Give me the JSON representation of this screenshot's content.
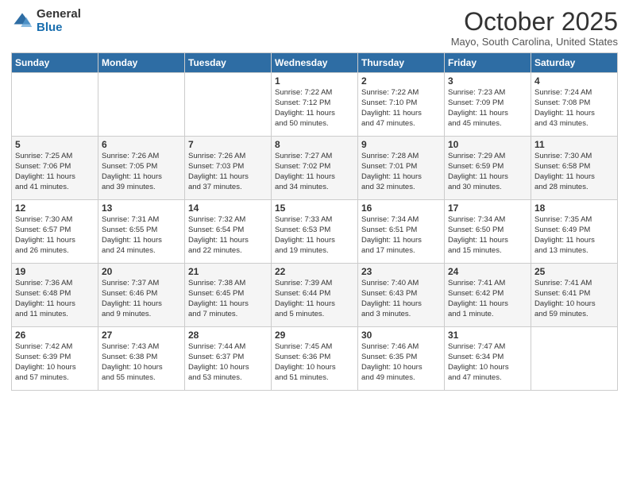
{
  "logo": {
    "general": "General",
    "blue": "Blue"
  },
  "title": "October 2025",
  "location": "Mayo, South Carolina, United States",
  "days_of_week": [
    "Sunday",
    "Monday",
    "Tuesday",
    "Wednesday",
    "Thursday",
    "Friday",
    "Saturday"
  ],
  "weeks": [
    [
      {
        "day": "",
        "info": ""
      },
      {
        "day": "",
        "info": ""
      },
      {
        "day": "",
        "info": ""
      },
      {
        "day": "1",
        "info": "Sunrise: 7:22 AM\nSunset: 7:12 PM\nDaylight: 11 hours\nand 50 minutes."
      },
      {
        "day": "2",
        "info": "Sunrise: 7:22 AM\nSunset: 7:10 PM\nDaylight: 11 hours\nand 47 minutes."
      },
      {
        "day": "3",
        "info": "Sunrise: 7:23 AM\nSunset: 7:09 PM\nDaylight: 11 hours\nand 45 minutes."
      },
      {
        "day": "4",
        "info": "Sunrise: 7:24 AM\nSunset: 7:08 PM\nDaylight: 11 hours\nand 43 minutes."
      }
    ],
    [
      {
        "day": "5",
        "info": "Sunrise: 7:25 AM\nSunset: 7:06 PM\nDaylight: 11 hours\nand 41 minutes."
      },
      {
        "day": "6",
        "info": "Sunrise: 7:26 AM\nSunset: 7:05 PM\nDaylight: 11 hours\nand 39 minutes."
      },
      {
        "day": "7",
        "info": "Sunrise: 7:26 AM\nSunset: 7:03 PM\nDaylight: 11 hours\nand 37 minutes."
      },
      {
        "day": "8",
        "info": "Sunrise: 7:27 AM\nSunset: 7:02 PM\nDaylight: 11 hours\nand 34 minutes."
      },
      {
        "day": "9",
        "info": "Sunrise: 7:28 AM\nSunset: 7:01 PM\nDaylight: 11 hours\nand 32 minutes."
      },
      {
        "day": "10",
        "info": "Sunrise: 7:29 AM\nSunset: 6:59 PM\nDaylight: 11 hours\nand 30 minutes."
      },
      {
        "day": "11",
        "info": "Sunrise: 7:30 AM\nSunset: 6:58 PM\nDaylight: 11 hours\nand 28 minutes."
      }
    ],
    [
      {
        "day": "12",
        "info": "Sunrise: 7:30 AM\nSunset: 6:57 PM\nDaylight: 11 hours\nand 26 minutes."
      },
      {
        "day": "13",
        "info": "Sunrise: 7:31 AM\nSunset: 6:55 PM\nDaylight: 11 hours\nand 24 minutes."
      },
      {
        "day": "14",
        "info": "Sunrise: 7:32 AM\nSunset: 6:54 PM\nDaylight: 11 hours\nand 22 minutes."
      },
      {
        "day": "15",
        "info": "Sunrise: 7:33 AM\nSunset: 6:53 PM\nDaylight: 11 hours\nand 19 minutes."
      },
      {
        "day": "16",
        "info": "Sunrise: 7:34 AM\nSunset: 6:51 PM\nDaylight: 11 hours\nand 17 minutes."
      },
      {
        "day": "17",
        "info": "Sunrise: 7:34 AM\nSunset: 6:50 PM\nDaylight: 11 hours\nand 15 minutes."
      },
      {
        "day": "18",
        "info": "Sunrise: 7:35 AM\nSunset: 6:49 PM\nDaylight: 11 hours\nand 13 minutes."
      }
    ],
    [
      {
        "day": "19",
        "info": "Sunrise: 7:36 AM\nSunset: 6:48 PM\nDaylight: 11 hours\nand 11 minutes."
      },
      {
        "day": "20",
        "info": "Sunrise: 7:37 AM\nSunset: 6:46 PM\nDaylight: 11 hours\nand 9 minutes."
      },
      {
        "day": "21",
        "info": "Sunrise: 7:38 AM\nSunset: 6:45 PM\nDaylight: 11 hours\nand 7 minutes."
      },
      {
        "day": "22",
        "info": "Sunrise: 7:39 AM\nSunset: 6:44 PM\nDaylight: 11 hours\nand 5 minutes."
      },
      {
        "day": "23",
        "info": "Sunrise: 7:40 AM\nSunset: 6:43 PM\nDaylight: 11 hours\nand 3 minutes."
      },
      {
        "day": "24",
        "info": "Sunrise: 7:41 AM\nSunset: 6:42 PM\nDaylight: 11 hours\nand 1 minute."
      },
      {
        "day": "25",
        "info": "Sunrise: 7:41 AM\nSunset: 6:41 PM\nDaylight: 10 hours\nand 59 minutes."
      }
    ],
    [
      {
        "day": "26",
        "info": "Sunrise: 7:42 AM\nSunset: 6:39 PM\nDaylight: 10 hours\nand 57 minutes."
      },
      {
        "day": "27",
        "info": "Sunrise: 7:43 AM\nSunset: 6:38 PM\nDaylight: 10 hours\nand 55 minutes."
      },
      {
        "day": "28",
        "info": "Sunrise: 7:44 AM\nSunset: 6:37 PM\nDaylight: 10 hours\nand 53 minutes."
      },
      {
        "day": "29",
        "info": "Sunrise: 7:45 AM\nSunset: 6:36 PM\nDaylight: 10 hours\nand 51 minutes."
      },
      {
        "day": "30",
        "info": "Sunrise: 7:46 AM\nSunset: 6:35 PM\nDaylight: 10 hours\nand 49 minutes."
      },
      {
        "day": "31",
        "info": "Sunrise: 7:47 AM\nSunset: 6:34 PM\nDaylight: 10 hours\nand 47 minutes."
      },
      {
        "day": "",
        "info": ""
      }
    ]
  ]
}
